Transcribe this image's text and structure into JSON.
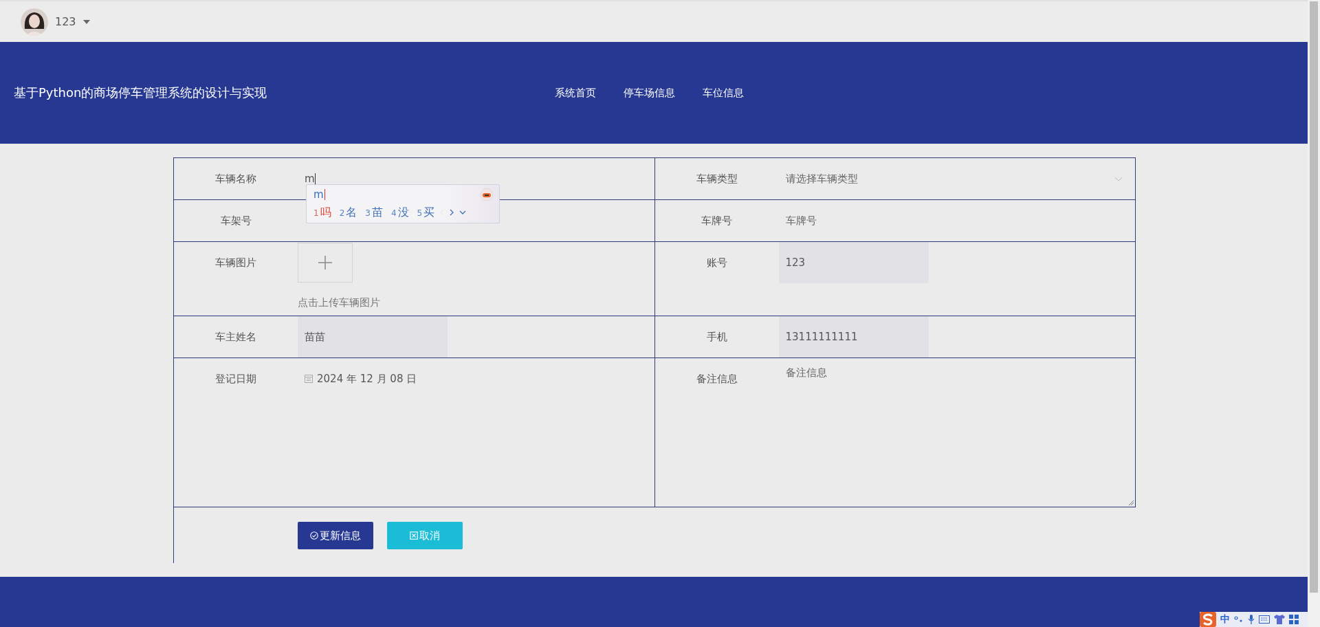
{
  "user_menu": {
    "username": "123"
  },
  "header": {
    "title": "基于Python的商场停车管理系统的设计与实现",
    "nav": [
      {
        "label": "系统首页"
      },
      {
        "label": "停车场信息"
      },
      {
        "label": "车位信息"
      }
    ]
  },
  "form": {
    "rows": [
      {
        "cells": [
          {
            "label": "车辆名称",
            "kind": "text",
            "value": "m",
            "focused": true
          },
          {
            "label": "车辆类型",
            "kind": "select",
            "placeholder": "请选择车辆类型"
          }
        ]
      },
      {
        "cells": [
          {
            "label": "车架号",
            "kind": "text"
          },
          {
            "label": "车牌号",
            "kind": "text",
            "placeholder": "车牌号"
          }
        ]
      },
      {
        "cells": [
          {
            "label": "车辆图片",
            "kind": "upload",
            "hint": "点击上传车辆图片"
          },
          {
            "label": "账号",
            "kind": "text",
            "value": "123",
            "disabled": true
          }
        ]
      },
      {
        "cells": [
          {
            "label": "车主姓名",
            "kind": "text",
            "value": "苗苗",
            "disabled": true
          },
          {
            "label": "手机",
            "kind": "text",
            "value": "13111111111",
            "disabled": true
          }
        ]
      },
      {
        "cells": [
          {
            "label": "登记日期",
            "kind": "date",
            "value": "2024 年 12 月 08 日"
          },
          {
            "label": "备注信息",
            "kind": "textarea",
            "placeholder": "备注信息"
          }
        ]
      }
    ],
    "buttons": [
      {
        "label": "更新信息",
        "kind": "primary"
      },
      {
        "label": "取消",
        "kind": "cancel"
      }
    ]
  },
  "ime_popup": {
    "input": "m",
    "candidates": [
      {
        "index": "1",
        "text": "吗",
        "selected": true
      },
      {
        "index": "2",
        "text": "名",
        "selected": false
      },
      {
        "index": "3",
        "text": "苗",
        "selected": false
      },
      {
        "index": "4",
        "text": "没",
        "selected": false
      },
      {
        "index": "5",
        "text": "买",
        "selected": false
      }
    ]
  },
  "ime_toolbar": {
    "mode": "中"
  }
}
